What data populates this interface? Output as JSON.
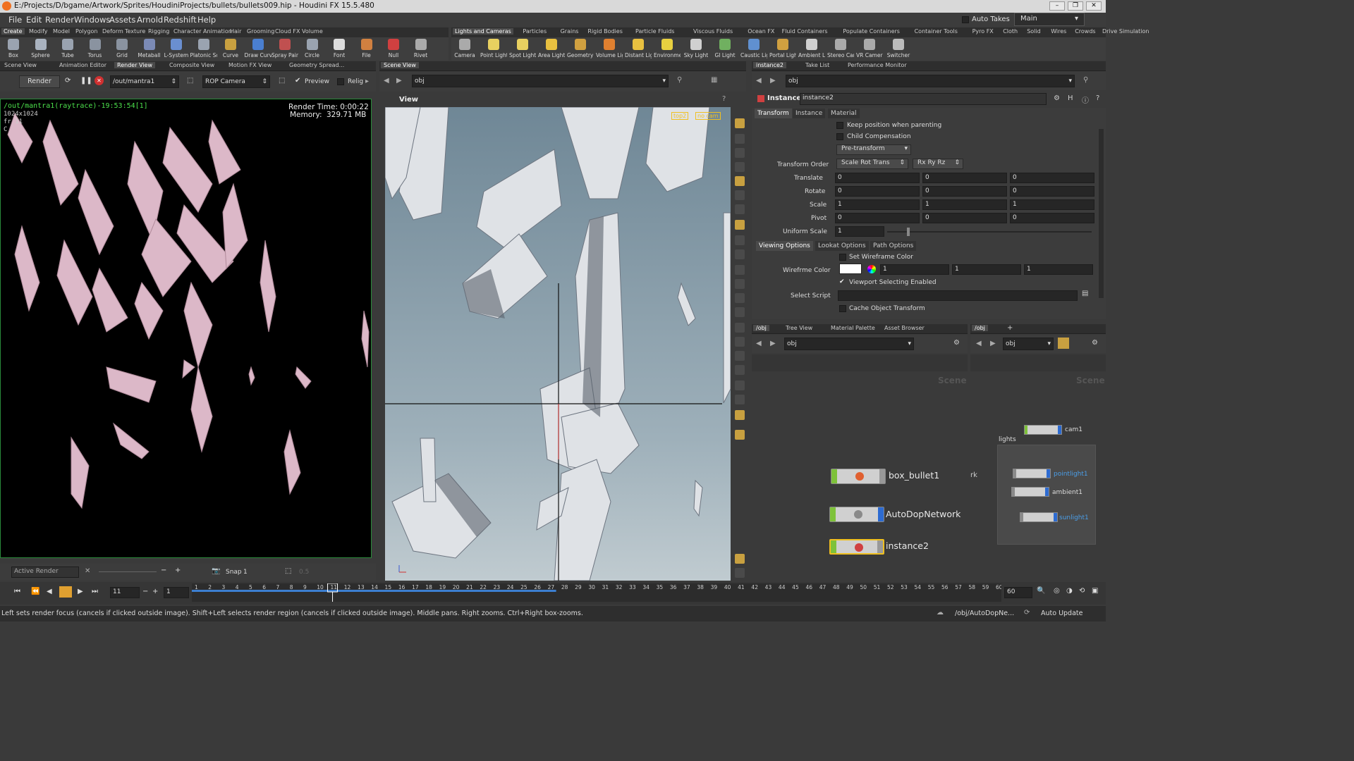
{
  "window": {
    "title": "E:/Projects/D/bgame/Artwork/Sprites/HoudiniProjects/bullets/bullets009.hip - Houdini FX 15.5.480"
  },
  "menu": [
    "File",
    "Edit",
    "Render",
    "Windows",
    "Assets",
    "Arnold",
    "Redshift",
    "Help"
  ],
  "top_right": {
    "auto_takes": "Auto Takes",
    "desktop": "Main"
  },
  "shelf_left_tabs": [
    "Create",
    "Modify",
    "Model",
    "Polygon",
    "Deform",
    "Texture",
    "Rigging",
    "Character",
    "Animation",
    "Hair",
    "Grooming",
    "Cloud FX",
    "Volume"
  ],
  "shelf_right_tabs": [
    "Lights and Cameras",
    "Particles",
    "Grains",
    "Rigid Bodies",
    "Particle Fluids",
    "Viscous Fluids",
    "Ocean FX",
    "Fluid Containers",
    "Populate Containers",
    "Container Tools",
    "Pyro FX",
    "Cloth",
    "Solid",
    "Wires",
    "Crowds",
    "Drive Simulation"
  ],
  "tools_left": [
    {
      "label": "Box",
      "color": "#9aa3b0"
    },
    {
      "label": "Sphere",
      "color": "#aab3c0"
    },
    {
      "label": "Tube",
      "color": "#9aa3b0"
    },
    {
      "label": "Torus",
      "color": "#8a93a0"
    },
    {
      "label": "Grid",
      "color": "#8a93a0"
    },
    {
      "label": "Metaball",
      "color": "#7b8ab5"
    },
    {
      "label": "L-System",
      "color": "#6a8fd0"
    },
    {
      "label": "Platonic Sol...",
      "color": "#9aa3b0"
    },
    {
      "label": "Curve",
      "color": "#c8a040"
    },
    {
      "label": "Draw Curve",
      "color": "#4a7fd0"
    },
    {
      "label": "Spray Paint",
      "color": "#c05050"
    },
    {
      "label": "Circle",
      "color": "#9aa3b0"
    },
    {
      "label": "Font",
      "color": "#dddddd"
    },
    {
      "label": "File",
      "color": "#d08040"
    },
    {
      "label": "Null",
      "color": "#d04040"
    },
    {
      "label": "Rivet",
      "color": "#aaaaaa"
    }
  ],
  "tools_right": [
    {
      "label": "Camera",
      "color": "#aaaaaa"
    },
    {
      "label": "Point Light",
      "color": "#e8d060"
    },
    {
      "label": "Spot Light",
      "color": "#e8d060"
    },
    {
      "label": "Area Light",
      "color": "#e8c040"
    },
    {
      "label": "Geometry L...",
      "color": "#d0a040"
    },
    {
      "label": "Volume Light",
      "color": "#e08030"
    },
    {
      "label": "Distant Light",
      "color": "#e8c040"
    },
    {
      "label": "Environmen...",
      "color": "#e8d040"
    },
    {
      "label": "Sky Light",
      "color": "#d0d0d0"
    },
    {
      "label": "GI Light",
      "color": "#70b060"
    },
    {
      "label": "Caustic Light",
      "color": "#6090d0"
    },
    {
      "label": "Portal Light",
      "color": "#d0a040"
    },
    {
      "label": "Ambient Lig...",
      "color": "#d0d0d0"
    },
    {
      "label": "Stereo Cam...",
      "color": "#aaaaaa"
    },
    {
      "label": "VR Camera",
      "color": "#aaaaaa"
    },
    {
      "label": "Switcher",
      "color": "#bbbbbb"
    }
  ],
  "render_pane": {
    "tabs": [
      "Scene View",
      "Animation Editor",
      "Render View",
      "Composite View",
      "Motion FX View",
      "Geometry Spread..."
    ],
    "render_button": "Render",
    "output": "/out/mantra1",
    "camera": "ROP Camera",
    "preview": "Preview",
    "relig": "Relig",
    "overlay_path": "/out/mantra1(raytrace)-19:53:54[1]",
    "resolution": "1024x1024",
    "frame": "fr 11",
    "channel": "C",
    "render_time": "Render Time: 0:00:22",
    "memory_label": "Memory:",
    "memory_value": "329.71 MB",
    "footer_active": "Active Render",
    "snap": "Snap",
    "snap_value": "1",
    "footer_num": "0.5"
  },
  "scene_view": {
    "tab": "Scene View",
    "path": "obj",
    "title": "View",
    "top_badge": "top2",
    "cam_badge": "no cam"
  },
  "params": {
    "tabs": [
      "instance2",
      "Take List",
      "Performance Monitor"
    ],
    "path": "obj",
    "node_type": "Instance",
    "node_name": "instance2",
    "subtabs": [
      "Transform",
      "Instance",
      "Material"
    ],
    "keep_position": "Keep position when parenting",
    "child_comp": "Child Compensation",
    "pretransform": "Pre-transform",
    "transform_order_label": "Transform Order",
    "transform_order": "Scale Rot Trans",
    "rot_order": "Rx Ry Rz",
    "translate": {
      "label": "Translate",
      "v": [
        "0",
        "0",
        "0"
      ]
    },
    "rotate": {
      "label": "Rotate",
      "v": [
        "0",
        "0",
        "0"
      ]
    },
    "scale": {
      "label": "Scale",
      "v": [
        "1",
        "1",
        "1"
      ]
    },
    "pivot": {
      "label": "Pivot",
      "v": [
        "0",
        "0",
        "0"
      ]
    },
    "uniform_scale": {
      "label": "Uniform Scale",
      "v": "1"
    },
    "subtabs2": [
      "Viewing Options",
      "Lookat Options",
      "Path Options"
    ],
    "set_wire": "Set Wireframe Color",
    "wire_label": "Wirefrme Color",
    "wire_vals": [
      "1",
      "1",
      "1"
    ],
    "viewport_sel": "Viewport Selecting Enabled",
    "select_script": "Select Script",
    "cache_obj": "Cache Object Transform"
  },
  "network": {
    "tabs": [
      "/obj",
      "Tree View",
      "Material Palette",
      "Asset Browser"
    ],
    "path": "obj",
    "scene_label": "Scene",
    "nodes": [
      "box_bullet1",
      "AutoDopNetwork",
      "instance2"
    ]
  },
  "network2": {
    "tab": "/obj",
    "path": "obj",
    "scene_label": "Scene",
    "cam": "cam1",
    "group": "lights",
    "lights": [
      "pointlight1",
      "ambient1",
      "sunlight1"
    ],
    "cut_label": "rk"
  },
  "timeline": {
    "frame": "11",
    "step": "1",
    "ticks": [
      1,
      2,
      3,
      4,
      5,
      6,
      7,
      8,
      9,
      10,
      11,
      12,
      13,
      14,
      15,
      16,
      17,
      18,
      19,
      20,
      21,
      22,
      23,
      24,
      25,
      26,
      27,
      28,
      29,
      30,
      31,
      32,
      33,
      34,
      35,
      36,
      37,
      38,
      39,
      40,
      41,
      42,
      43,
      44,
      45,
      46,
      47,
      48,
      49,
      50,
      51,
      52,
      53,
      54,
      55,
      56,
      57,
      58,
      59,
      60
    ],
    "current": 11,
    "end": "60"
  },
  "status": {
    "message": "Left sets render focus (cancels if clicked outside image). Shift+Left selects render region (cancels if clicked outside image). Middle pans. Right zooms. Ctrl+Right box-zooms.",
    "path": "/obj/AutoDopNe...",
    "update": "Auto Update"
  },
  "shard_color": "#dcb8c8",
  "accent": "#f0c020"
}
